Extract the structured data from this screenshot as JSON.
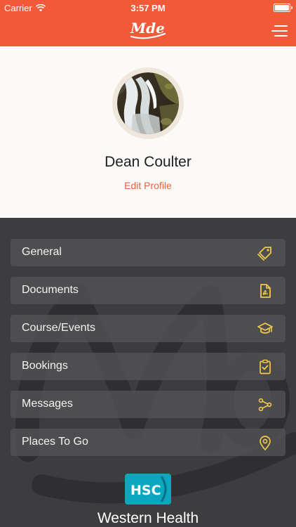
{
  "status_bar": {
    "carrier": "Carrier",
    "time": "3:57 PM",
    "battery_level": 1.0
  },
  "nav": {
    "logo_text": "Mde",
    "menu_icon": "hamburger-icon"
  },
  "profile": {
    "name": "Dean Coulter",
    "edit_label": "Edit Profile"
  },
  "menu": {
    "items": [
      {
        "label": "General",
        "icon": "tags-icon"
      },
      {
        "label": "Documents",
        "icon": "pdf-document-icon"
      },
      {
        "label": "Course/Events",
        "icon": "graduation-cap-icon"
      },
      {
        "label": "Bookings",
        "icon": "clipboard-check-icon"
      },
      {
        "label": "Messages",
        "icon": "share-nodes-icon"
      },
      {
        "label": "Places To Go",
        "icon": "map-pin-icon"
      }
    ]
  },
  "footer": {
    "logo_text": "HSC",
    "org_name": "Western Health"
  },
  "colors": {
    "brand_orange": "#f05a38",
    "icon_yellow": "#f2c94c",
    "dark_bg": "#3d3d3f",
    "profile_bg": "#fbfaf8"
  }
}
